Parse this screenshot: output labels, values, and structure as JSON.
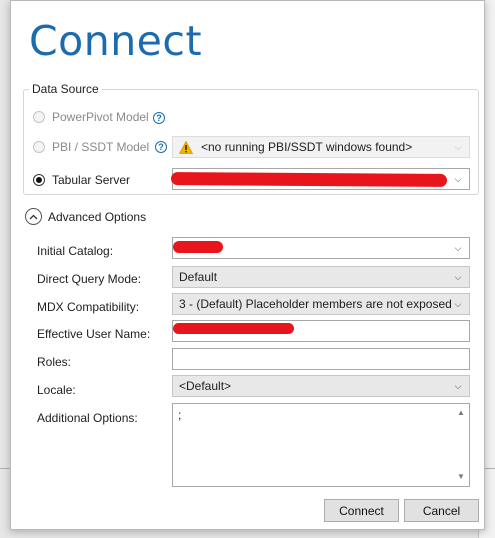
{
  "dialog": {
    "title": "Connect",
    "data_source_legend": "Data Source",
    "data_source": {
      "powerpivot_label": "PowerPivot Model",
      "pbi_label": "PBI / SSDT Model",
      "pbi_value": "<no running PBI/SSDT windows found>",
      "tabular_label": "Tabular Server",
      "tabular_value": "",
      "selected": "Tabular Server"
    },
    "advanced": {
      "toggle_label": "Advanced Options",
      "initial_catalog_label": "Initial Catalog:",
      "initial_catalog_value": "",
      "direct_query_label": "Direct Query Mode:",
      "direct_query_value": "Default",
      "mdx_label": "MDX Compatibility:",
      "mdx_value": "3 - (Default) Placeholder members are not exposed",
      "effective_user_label": "Effective User Name:",
      "effective_user_value": "",
      "roles_label": "Roles:",
      "roles_value": "",
      "locale_label": "Locale:",
      "locale_value": "<Default>",
      "additional_label": "Additional Options:",
      "additional_value": ";"
    },
    "buttons": {
      "connect": "Connect",
      "cancel": "Cancel"
    }
  },
  "colors": {
    "title": "#1c6bad",
    "redaction": "#e8151c",
    "warning": "#f2b400"
  },
  "icons": [
    "help-icon",
    "warning-icon",
    "chevron-down-icon",
    "chevron-up-icon",
    "scroll-up-icon",
    "scroll-down-icon"
  ]
}
